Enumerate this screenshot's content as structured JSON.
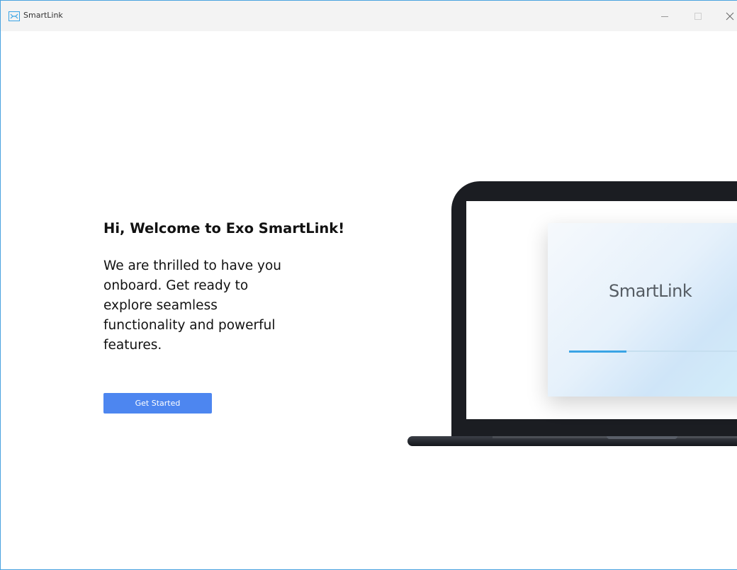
{
  "window": {
    "title": "SmartLink",
    "icon": "smartlink-app-icon",
    "controls": {
      "minimize": "minimize-icon",
      "maximize": "maximize-icon",
      "close": "close-icon"
    }
  },
  "welcome": {
    "heading": "Hi, Welcome to Exo SmartLink!",
    "body": "We are thrilled to have you onboard. Get ready to explore seamless functionality and powerful features.",
    "button_label": "Get Started"
  },
  "illustration": {
    "splash_title": "SmartLink",
    "progress": 0.3
  },
  "colors": {
    "accent": "#4d86f0",
    "progress": "#3aa4e5",
    "window_border": "#4aa3df"
  }
}
